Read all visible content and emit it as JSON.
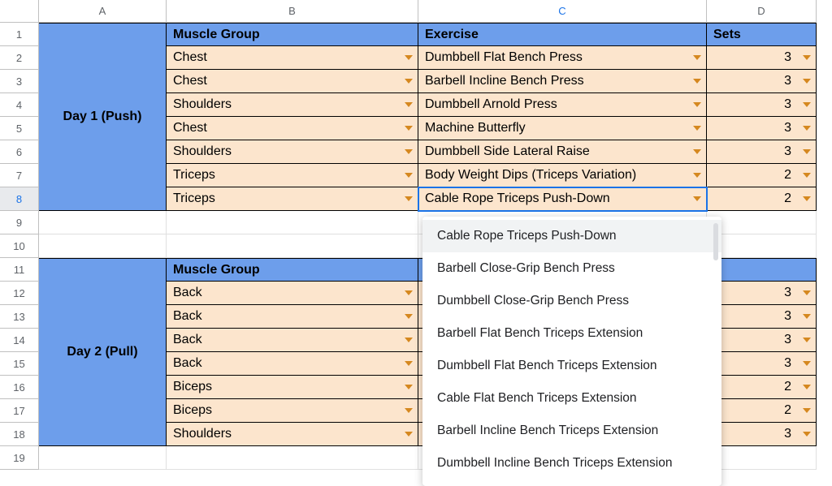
{
  "columns": [
    "A",
    "B",
    "C",
    "D"
  ],
  "day1": {
    "label": "Day 1 (Push)"
  },
  "day2": {
    "label": "Day 2 (Pull)"
  },
  "headers": {
    "muscle": "Muscle Group",
    "exercise": "Exercise",
    "sets": "Sets"
  },
  "day1_rows": [
    {
      "muscle": "Chest",
      "exercise": "Dumbbell Flat Bench Press",
      "sets": "3"
    },
    {
      "muscle": "Chest",
      "exercise": "Barbell Incline Bench Press",
      "sets": "3"
    },
    {
      "muscle": "Shoulders",
      "exercise": "Dumbbell Arnold Press",
      "sets": "3"
    },
    {
      "muscle": "Chest",
      "exercise": "Machine Butterfly",
      "sets": "3"
    },
    {
      "muscle": "Shoulders",
      "exercise": "Dumbbell Side Lateral Raise",
      "sets": "3"
    },
    {
      "muscle": "Triceps",
      "exercise": "Body Weight Dips (Triceps Variation)",
      "sets": "2"
    },
    {
      "muscle": "Triceps",
      "exercise": "Cable Rope Triceps Push-Down",
      "sets": "2"
    }
  ],
  "day2_rows": [
    {
      "muscle": "Back",
      "sets": "3"
    },
    {
      "muscle": "Back",
      "sets": "3"
    },
    {
      "muscle": "Back",
      "sets": "3"
    },
    {
      "muscle": "Back",
      "sets": "3"
    },
    {
      "muscle": "Biceps",
      "sets": "2"
    },
    {
      "muscle": "Biceps",
      "sets": "2"
    },
    {
      "muscle": "Shoulders",
      "sets": "3"
    }
  ],
  "dropdown": {
    "options": [
      "Cable Rope Triceps Push-Down",
      "Barbell Close-Grip Bench Press",
      "Dumbbell Close-Grip Bench Press",
      "Barbell Flat Bench Triceps Extension",
      "Dumbbell Flat Bench Triceps Extension",
      "Cable Flat Bench Triceps Extension",
      "Barbell Incline Bench Triceps Extension",
      "Dumbbell Incline Bench Triceps Extension"
    ],
    "active_index": 0
  },
  "selected_cell": "C8",
  "setsTrailChar": "s"
}
